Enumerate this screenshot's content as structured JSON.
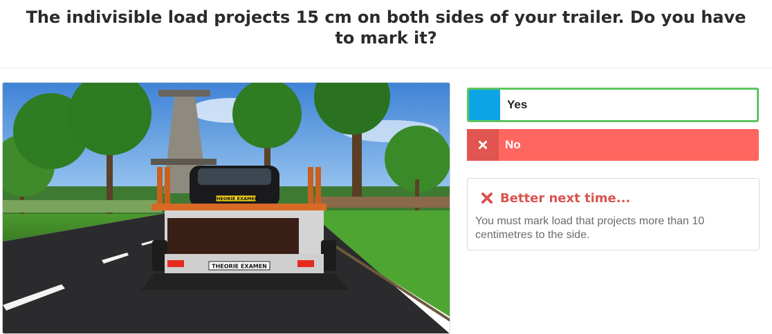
{
  "question": {
    "text": "The indivisible load projects 15 cm on both sides of your trailer. Do you have to mark it?"
  },
  "scene": {
    "plate_car": "THEORIE EXAMEN",
    "plate_trailer": "THEORIE EXAMEN"
  },
  "answers": [
    {
      "label": "Yes",
      "state": "selected-correct",
      "tile_color": "#0da5e6",
      "border_color": "#5cc55f"
    },
    {
      "label": "No",
      "state": "wrong",
      "icon": "close-icon",
      "bg_color": "#ff6660"
    }
  ],
  "feedback": {
    "icon": "close-icon",
    "title": "Better next time...",
    "text": "You must mark load that projects more than 10 centimetres to the side.",
    "color": "#d9534f"
  }
}
